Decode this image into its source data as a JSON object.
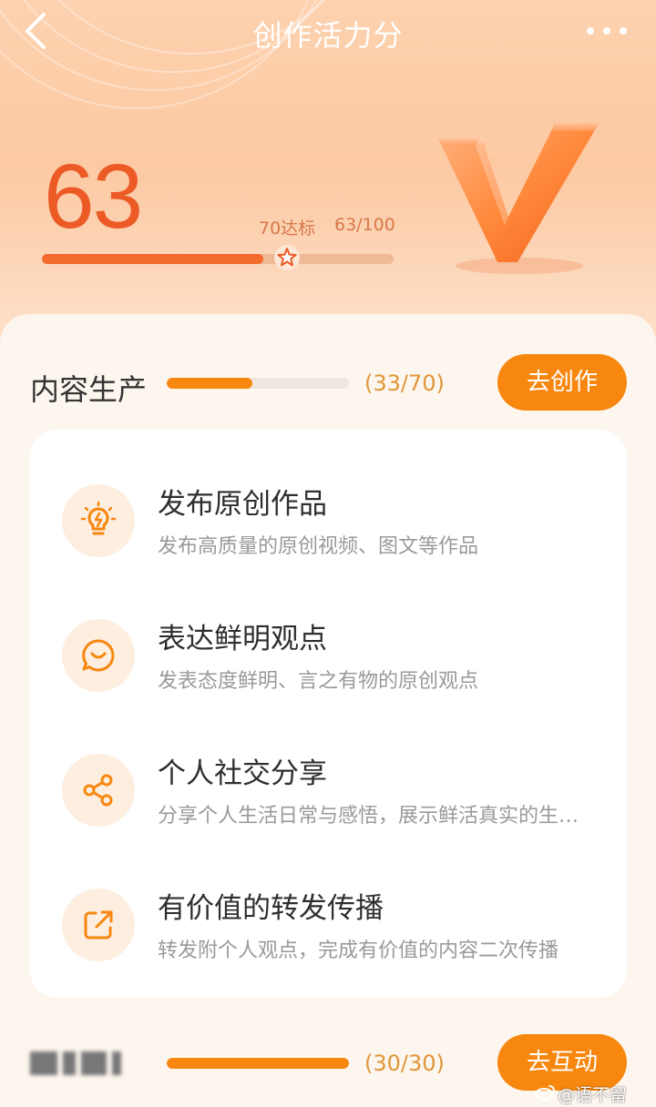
{
  "header": {
    "title": "创作活力分",
    "back_icon": "chevron-left-icon",
    "more_icon": "more-horizontal-icon"
  },
  "score": {
    "value": "63",
    "target_label": "70达标",
    "ratio_label": "63/100",
    "progress": 0.63,
    "target_fraction": 0.7,
    "marker_icon": "star-icon"
  },
  "sections": [
    {
      "title": "内容生产",
      "count_label": "(33/70)",
      "progress": 0.4714,
      "button_label": "去创作",
      "items": [
        {
          "icon": "lightbulb-icon",
          "title": "发布原创作品",
          "desc": "发布高质量的原创视频、图文等作品"
        },
        {
          "icon": "chat-smile-icon",
          "title": "表达鲜明观点",
          "desc": "发表态度鲜明、言之有物的原创观点"
        },
        {
          "icon": "share-icon",
          "title": "个人社交分享",
          "desc": "分享个人生活日常与感悟，展示鲜活真实的生活态度"
        },
        {
          "icon": "repost-icon",
          "title": "有价值的转发传播",
          "desc": "转发附个人观点，完成有价值的内容二次传播"
        }
      ]
    },
    {
      "title": "",
      "count_label": "(30/30)",
      "progress": 1.0,
      "button_label": "去互动"
    }
  ],
  "watermark": {
    "text": "@语不留"
  },
  "colors": {
    "accent": "#f7870f",
    "score": "#ec5a26",
    "hero_bg": "#fcc9a2",
    "page_bg": "#fdf6ee"
  }
}
